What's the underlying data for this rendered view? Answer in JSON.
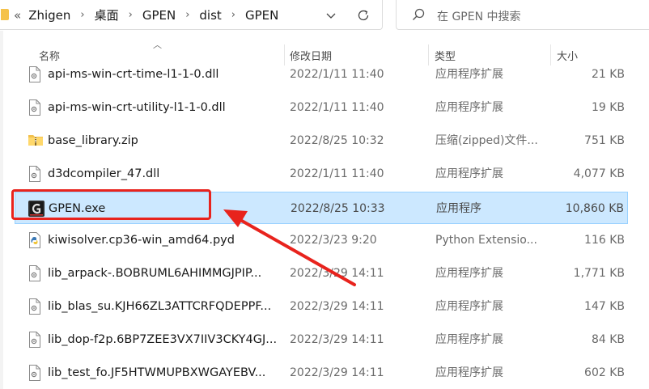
{
  "address_bar": {
    "overflow_glyph": "«",
    "breadcrumbs": [
      "Zhigen",
      "桌面",
      "GPEN",
      "dist",
      "GPEN"
    ]
  },
  "search": {
    "placeholder": "在 GPEN 中搜索"
  },
  "columns": {
    "name": "名称",
    "date": "修改日期",
    "type": "类型",
    "size": "大小"
  },
  "files": [
    {
      "name": "api-ms-win-crt-time-l1-1-0.dll",
      "date": "2022/1/11 11:40",
      "type": "应用程序扩展",
      "size": "21 KB",
      "icon": "dll-file-icon",
      "selected": false
    },
    {
      "name": "api-ms-win-crt-utility-l1-1-0.dll",
      "date": "2022/1/11 11:40",
      "type": "应用程序扩展",
      "size": "19 KB",
      "icon": "dll-file-icon",
      "selected": false
    },
    {
      "name": "base_library.zip",
      "date": "2022/8/25 10:32",
      "type": "压缩(zipped)文件...",
      "size": "751 KB",
      "icon": "zip-folder-icon",
      "selected": false
    },
    {
      "name": "d3dcompiler_47.dll",
      "date": "2022/1/11 11:40",
      "type": "应用程序扩展",
      "size": "4,077 KB",
      "icon": "dll-file-icon",
      "selected": false
    },
    {
      "name": "GPEN.exe",
      "date": "2022/8/25 10:33",
      "type": "应用程序",
      "size": "10,860 KB",
      "icon": "gpen-app-icon",
      "selected": true
    },
    {
      "name": "kiwisolver.cp36-win_amd64.pyd",
      "date": "2022/3/23 9:20",
      "type": "Python Extensio...",
      "size": "116 KB",
      "icon": "python-file-icon",
      "selected": false
    },
    {
      "name": "lib_arpack-.BOBRUML6AHIMMGJPIP...",
      "date": "2022/3/29 14:11",
      "type": "应用程序扩展",
      "size": "1,771 KB",
      "icon": "dll-file-icon",
      "selected": false
    },
    {
      "name": "lib_blas_su.KJH66ZL3ATTCRFQDEPPF...",
      "date": "2022/3/29 14:11",
      "type": "应用程序扩展",
      "size": "147 KB",
      "icon": "dll-file-icon",
      "selected": false
    },
    {
      "name": "lib_dop-f2p.6BP7ZEE3VX7IIV3CKY4GJ...",
      "date": "2022/3/29 14:11",
      "type": "应用程序扩展",
      "size": "84 KB",
      "icon": "dll-file-icon",
      "selected": false
    },
    {
      "name": "lib_test_fo.JF5HTWMUPBXWGAYEBV...",
      "date": "2022/3/29 14:11",
      "type": "应用程序扩展",
      "size": "602 KB",
      "icon": "dll-file-icon",
      "selected": false
    }
  ],
  "colors": {
    "selection_fill": "#cce8ff",
    "selection_border": "#99d1ff",
    "annotation_red": "#e8231d"
  }
}
